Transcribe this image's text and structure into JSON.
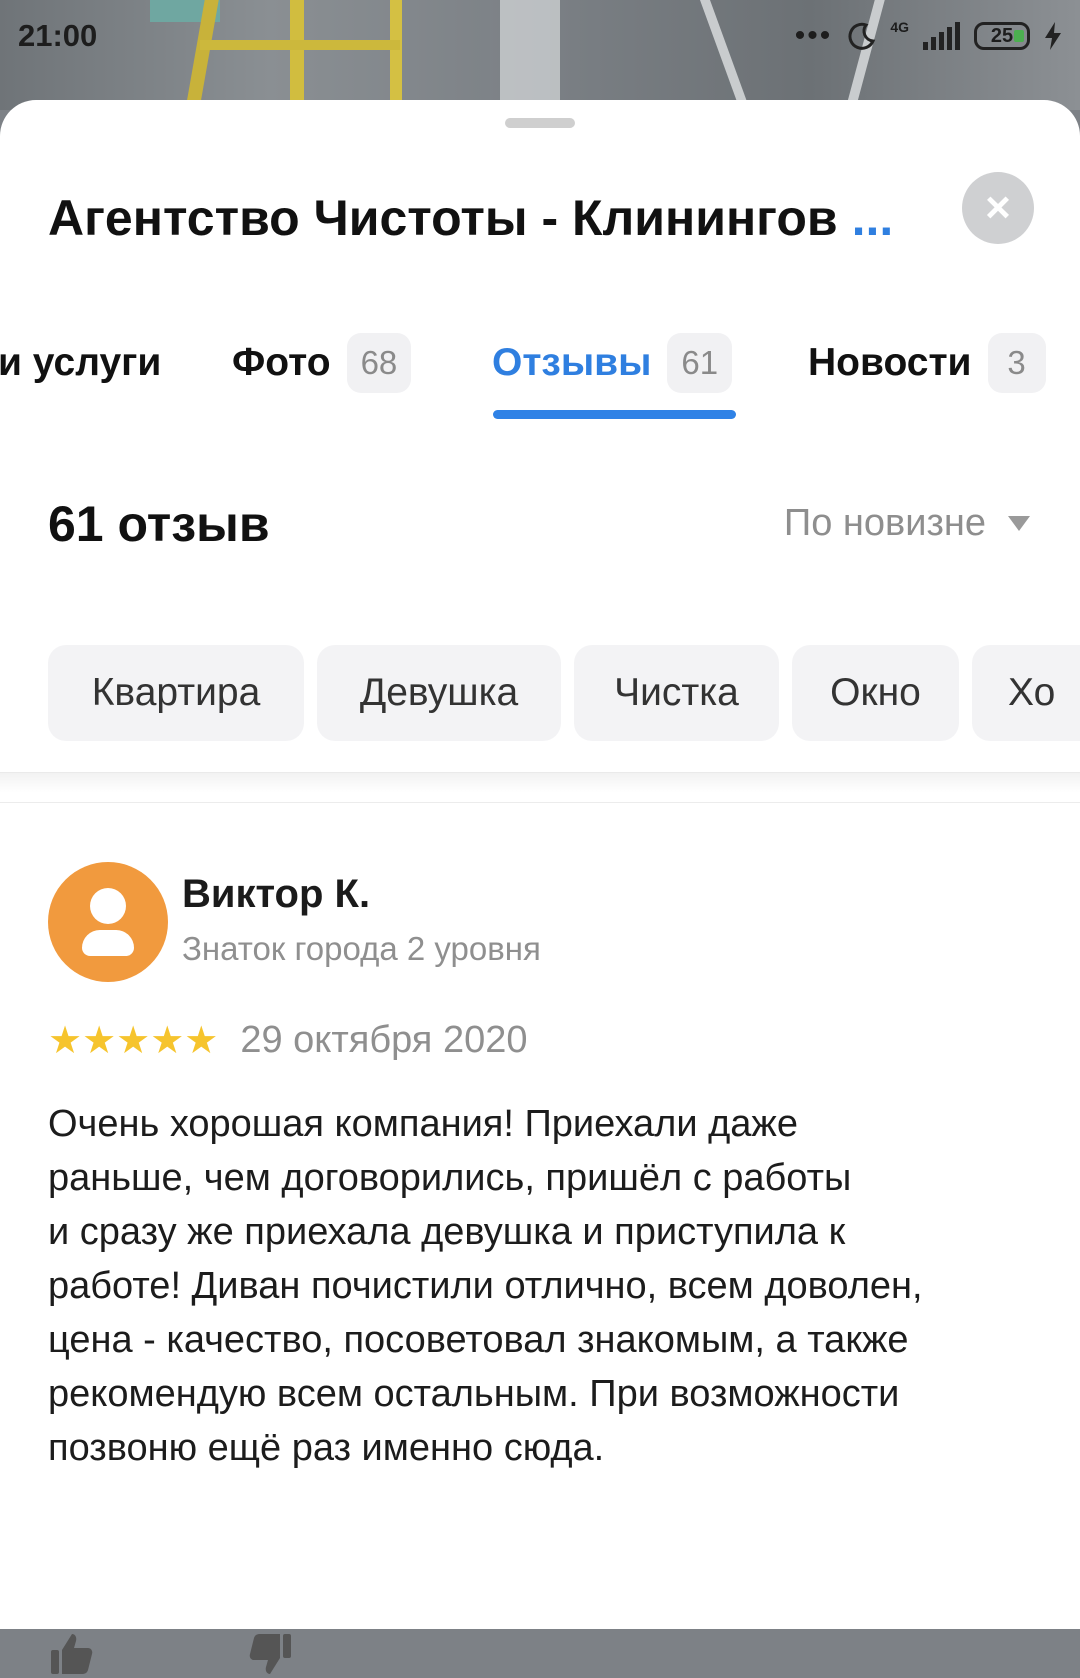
{
  "status_bar": {
    "time": "21:00",
    "dots": "•••",
    "network": "4G",
    "battery": "25"
  },
  "sheet": {
    "title": "Агентство Чистоты - Клинингов",
    "title_more": "...",
    "close_icon": "×"
  },
  "tabs": [
    {
      "label": "и услуги",
      "count": ""
    },
    {
      "label": "Фото",
      "count": "68"
    },
    {
      "label": "Отзывы",
      "count": "61",
      "active": true
    },
    {
      "label": "Новости",
      "count": "3"
    }
  ],
  "reviews_header": {
    "summary": "61 отзыв",
    "sort_label": "По новизне"
  },
  "chips": [
    "Квартира",
    "Девушка",
    "Чистка",
    "Окно",
    "Хо"
  ],
  "review": {
    "author": "Виктор К.",
    "level": "Знаток города 2 уровня",
    "rating": 5,
    "stars": "★★★★★",
    "date": "29 октября 2020",
    "text": "Очень хорошая компания! Приехали даже\nраньше, чем договорились, пришёл с работы\nи сразу же приехала девушка и приступила к\nработе! Диван почистили отлично, всем доволен,\nцена - качество, посоветовал знакомым, а также\nрекомендую всем остальным. При возможности\nпозвоню ещё раз именно сюда."
  },
  "colors": {
    "accent": "#2f7fe0",
    "avatar": "#f19a3e",
    "star": "#f6c42d"
  },
  "icons": [
    "moon-icon",
    "signal-icon",
    "battery-icon",
    "close-icon",
    "chevron-down-icon",
    "user-icon",
    "thumbs-up-icon",
    "thumbs-down-icon"
  ]
}
